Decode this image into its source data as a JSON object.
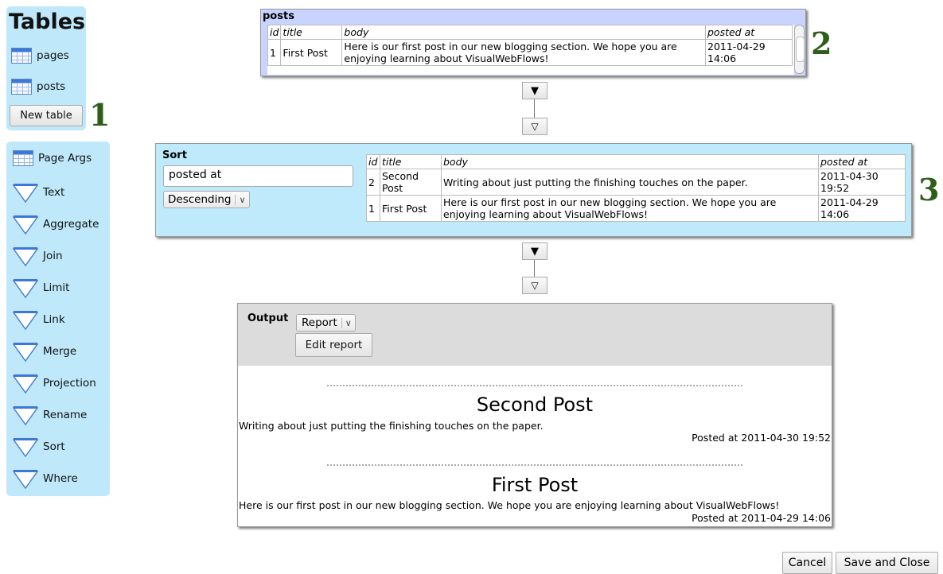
{
  "tables_palette": {
    "title": "Tables",
    "items": [
      {
        "label": "pages",
        "icon": "table-icon"
      },
      {
        "label": "posts",
        "icon": "table-icon"
      }
    ],
    "new_table_label": "New table"
  },
  "annotations": [
    "1",
    "2",
    "3"
  ],
  "operators_palette": {
    "items": [
      {
        "label": "Page Args",
        "icon": "table-icon"
      },
      {
        "label": "Text",
        "icon": "funnel-icon"
      },
      {
        "label": "Aggregate",
        "icon": "funnel-icon"
      },
      {
        "label": "Join",
        "icon": "funnel-icon"
      },
      {
        "label": "Limit",
        "icon": "funnel-icon"
      },
      {
        "label": "Link",
        "icon": "funnel-icon"
      },
      {
        "label": "Merge",
        "icon": "funnel-icon"
      },
      {
        "label": "Projection",
        "icon": "funnel-icon"
      },
      {
        "label": "Rename",
        "icon": "funnel-icon"
      },
      {
        "label": "Sort",
        "icon": "funnel-icon"
      },
      {
        "label": "Where",
        "icon": "funnel-icon"
      }
    ]
  },
  "posts_panel": {
    "title": "posts",
    "columns": [
      "id",
      "title",
      "body",
      "posted at"
    ],
    "rows": [
      [
        "1",
        "First Post",
        "Here is our first post in our new blogging section. We hope you are enjoying learning about VisualWebFlows!",
        "2011-04-29 14:06"
      ]
    ]
  },
  "connectors": {
    "down_filled": "▼",
    "down_outline": "▽"
  },
  "sort_panel": {
    "label": "Sort",
    "field_value": "posted at",
    "order_value": "Descending",
    "columns": [
      "id",
      "title",
      "body",
      "posted at"
    ],
    "rows": [
      [
        "2",
        "Second Post",
        "Writing about just putting the finishing touches on the paper.",
        "2011-04-30 19:52"
      ],
      [
        "1",
        "First Post",
        "Here is our first post in our new blogging section. We hope you are enjoying learning about VisualWebFlows!",
        "2011-04-29 14:06"
      ]
    ]
  },
  "output_panel": {
    "label": "Output",
    "mode_value": "Report",
    "edit_label": "Edit report",
    "posts": [
      {
        "title": "Second Post",
        "body": "Writing about just putting the finishing touches on the paper.",
        "meta": "Posted at 2011-04-30 19:52"
      },
      {
        "title": "First Post",
        "body": "Here is our first post in our new blogging section. We hope you are enjoying learning about VisualWebFlows!",
        "meta": "Posted at 2011-04-29 14:06"
      }
    ]
  },
  "footer": {
    "cancel_label": "Cancel",
    "save_label": "Save and Close"
  },
  "colors": {
    "palette_bg": "#bfe9fb",
    "posts_bg": "#c9d3ff",
    "sort_bg": "#bfeafb",
    "annotation": "#2e5e1a"
  }
}
